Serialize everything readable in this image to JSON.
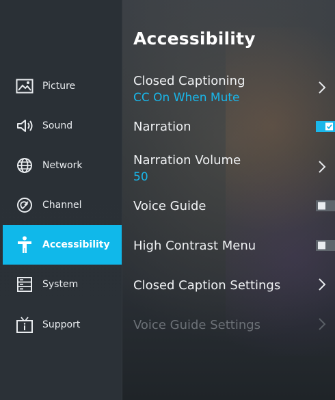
{
  "sidebar": {
    "items": [
      {
        "label": "Picture",
        "icon": "picture-icon",
        "active": false
      },
      {
        "label": "Sound",
        "icon": "speaker-icon",
        "active": false
      },
      {
        "label": "Network",
        "icon": "globe-icon",
        "active": false
      },
      {
        "label": "Channel",
        "icon": "satellite-dish-icon",
        "active": false
      },
      {
        "label": "Accessibility",
        "icon": "accessibility-person-icon",
        "active": true
      },
      {
        "label": "System",
        "icon": "server-rack-icon",
        "active": false
      },
      {
        "label": "Support",
        "icon": "tv-info-icon",
        "active": false
      }
    ]
  },
  "panel": {
    "title": "Accessibility",
    "rows": [
      {
        "label": "Closed Captioning",
        "value": "CC On When Mute",
        "control": "chevron"
      },
      {
        "label": "Narration",
        "control": "toggle",
        "state": "on"
      },
      {
        "label": "Narration Volume",
        "value": "50",
        "control": "chevron"
      },
      {
        "label": "Voice Guide",
        "control": "toggle",
        "state": "off"
      },
      {
        "label": "High Contrast Menu",
        "control": "toggle",
        "state": "off"
      },
      {
        "label": "Closed Caption Settings",
        "control": "chevron"
      },
      {
        "label": "Voice Guide Settings",
        "control": "chevron",
        "disabled": true
      }
    ]
  },
  "colors": {
    "accent": "#10b8ea",
    "value_text": "#19b7ea",
    "sidebar_bg": "#2a3036"
  }
}
